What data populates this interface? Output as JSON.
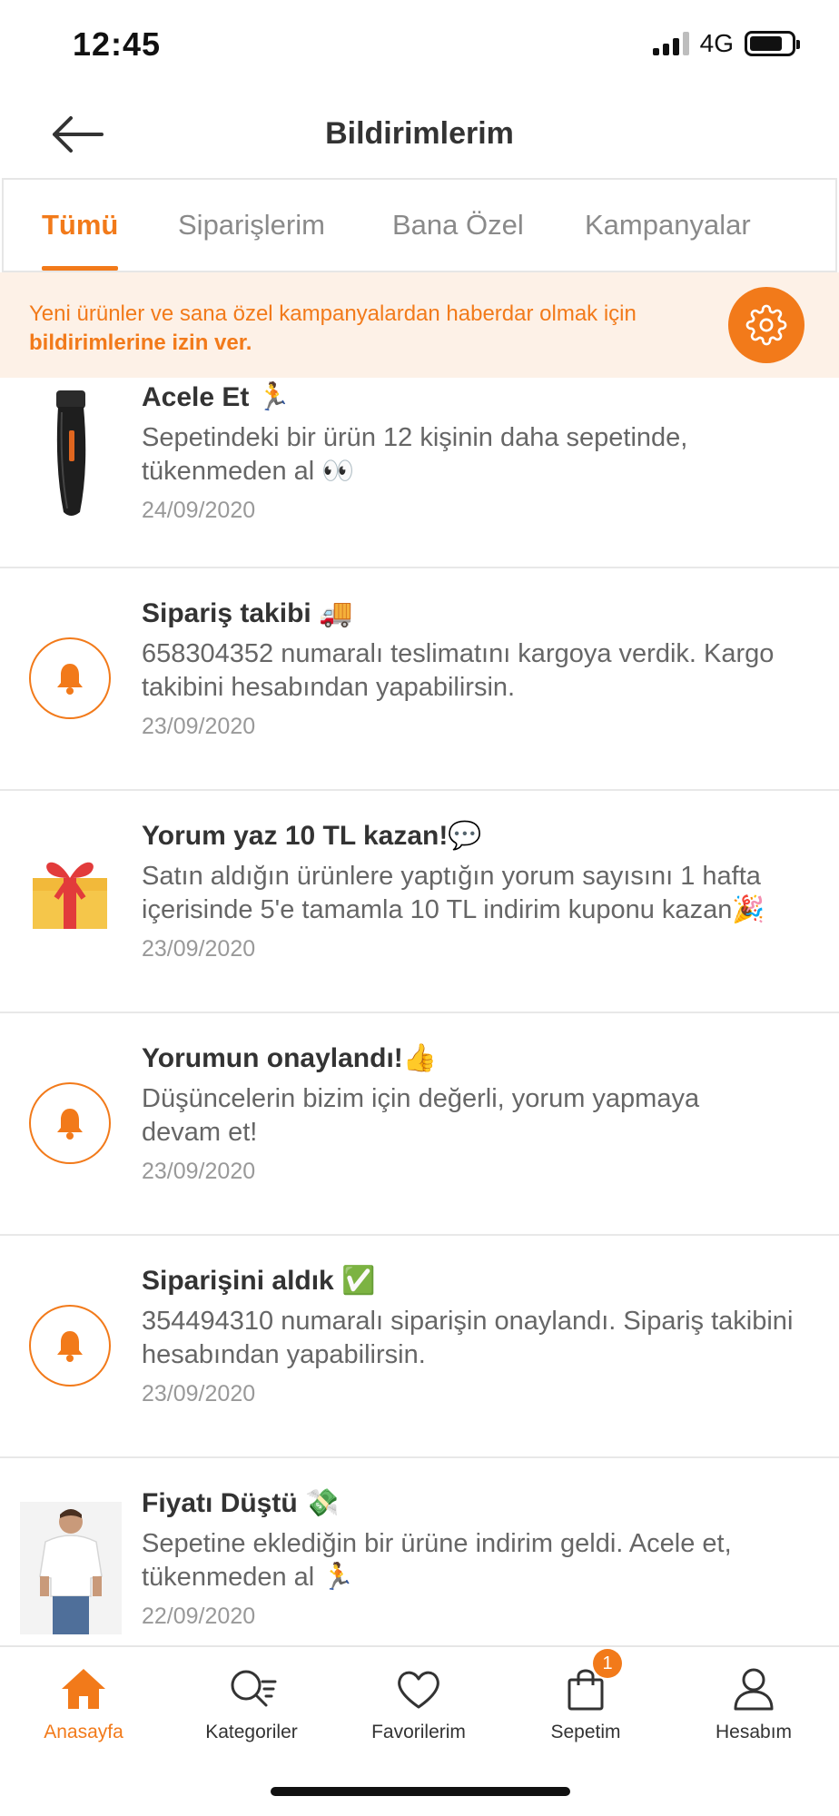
{
  "status_bar": {
    "time": "12:45",
    "network": "4G"
  },
  "header": {
    "title": "Bildirimlerim"
  },
  "tabs": [
    {
      "label": "Tümü",
      "active": true
    },
    {
      "label": "Siparişlerim",
      "active": false
    },
    {
      "label": "Bana Özel",
      "active": false
    },
    {
      "label": "Kampanyalar",
      "active": false
    }
  ],
  "banner": {
    "text_part1": "Yeni ürünler ve sana özel kampanyalardan haberdar olmak için ",
    "text_bold": "bildirimlerine izin ver."
  },
  "notifications": [
    {
      "title": "Acele Et 🏃",
      "body": "Sepetindeki bir ürün 12 kişinin daha sepetinde, tükenmeden al 👀",
      "date": "24/09/2020",
      "icon": "trimmer-thumbnail"
    },
    {
      "title": "Sipariş takibi 🚚",
      "body": "658304352 numaralı teslimatını kargoya verdik. Kargo takibini hesabından yapabilirsin.",
      "date": "23/09/2020",
      "icon": "bell-icon"
    },
    {
      "title": "Yorum yaz 10 TL kazan!💬",
      "body": "Satın aldığın ürünlere yaptığın yorum sayısını 1 hafta içerisinde 5'e tamamla 10 TL indirim kuponu kazan🎉",
      "date": "23/09/2020",
      "icon": "gift-icon"
    },
    {
      "title": "Yorumun onaylandı!👍",
      "body": "Düşüncelerin bizim için değerli, yorum yapmaya devam et!",
      "date": "23/09/2020",
      "icon": "bell-icon"
    },
    {
      "title": "Siparişini aldık ✅",
      "body": "354494310 numaralı siparişin onaylandı. Sipariş takibini hesabından yapabilirsin.",
      "date": "23/09/2020",
      "icon": "bell-icon"
    },
    {
      "title": "Fiyatı Düştü 💸",
      "body": "Sepetine eklediğin bir ürüne indirim geldi. Acele et, tükenmeden al 🏃",
      "date": "22/09/2020",
      "icon": "tshirt-thumbnail"
    }
  ],
  "bottom_nav": [
    {
      "label": "Anasayfa",
      "icon": "home-icon",
      "active": true
    },
    {
      "label": "Kategoriler",
      "icon": "search-list-icon",
      "active": false
    },
    {
      "label": "Favorilerim",
      "icon": "heart-icon",
      "active": false
    },
    {
      "label": "Sepetim",
      "icon": "bag-icon",
      "badge": "1",
      "active": false
    },
    {
      "label": "Hesabım",
      "icon": "user-icon",
      "active": false
    }
  ],
  "colors": {
    "accent": "#f27a1a",
    "banner_bg": "#fdf1e7"
  }
}
